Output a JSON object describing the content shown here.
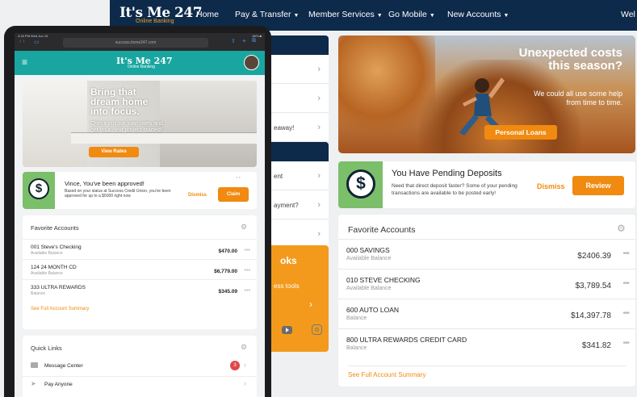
{
  "nav": {
    "logo": "It's Me 247",
    "logo_sub": "Online Banking",
    "items": [
      {
        "label": "Home",
        "caret": false
      },
      {
        "label": "Pay & Transfer",
        "caret": true
      },
      {
        "label": "Member Services",
        "caret": true
      },
      {
        "label": "Go Mobile",
        "caret": true
      },
      {
        "label": "New Accounts",
        "caret": true
      },
      {
        "label": "Wel",
        "caret": false
      }
    ]
  },
  "midcol": {
    "rows": [
      "",
      "",
      "eaway!",
      "ent",
      "ayment?",
      ""
    ],
    "orange_title": "oks",
    "orange_sub": "ess tools"
  },
  "banner": {
    "headline": "Unexpected costs this season?",
    "subtext": "We could all use some help from time to time.",
    "button": "Personal Loans"
  },
  "pending": {
    "title": "You Have Pending Deposits",
    "text": "Need that direct deposit faster? Some of your pending transactions are available to be posted early!",
    "dismiss": "Dismiss",
    "review": "Review"
  },
  "favorites": {
    "title": "Favorite Accounts",
    "accounts": [
      {
        "name": "000 SAVINGS",
        "type": "Available Balance",
        "amount": "$2406.39"
      },
      {
        "name": "010 STEVE CHECKING",
        "type": "Available Balance",
        "amount": "$3,789.54"
      },
      {
        "name": "600 AUTO LOAN",
        "type": "Balance",
        "amount": "$14,397.78"
      },
      {
        "name": "800 ULTRA REWARDS CREDIT CARD",
        "type": "Balance",
        "amount": "$341.82"
      }
    ],
    "see_full": "See Full Account Summary"
  },
  "mobile": {
    "status_left": "4:18 PM  Wed Jun 15",
    "status_right": "86% ■",
    "url": "success.itsme247.com",
    "logo": "It's Me 247",
    "logo_sub": "Online Banking",
    "banner_headline": "Bring that dream home into focus.",
    "banner_sub": "Check out our loan rates and get your next project started!",
    "banner_button": "View Rates",
    "approval_title": "Vince, You've been approved!",
    "approval_text": "Based on your status at Success Credit Union, you've been approved for up to a $5000 right now",
    "approval_dismiss": "Dismiss",
    "approval_claim": "Claim",
    "fav_title": "Favorite Accounts",
    "accounts": [
      {
        "name": "001 Steve's Checking",
        "type": "Available Balance",
        "amount": "$470.00"
      },
      {
        "name": "124 24 MONTH CD",
        "type": "Available Balance",
        "amount": "$6,779.00"
      },
      {
        "name": "333 ULTRA REWARDS",
        "type": "Balance",
        "amount": "$345.09"
      }
    ],
    "see_full": "See Full Account Summary",
    "quick_title": "Quick Links",
    "quick_links": [
      {
        "label": "Message Center",
        "badge": "3"
      },
      {
        "label": "Pay Anyone",
        "badge": ""
      }
    ]
  },
  "colors": {
    "navy": "#0d2a4a",
    "orange": "#f08a10",
    "teal": "#1aa6a0",
    "green": "#7bbf6a"
  }
}
